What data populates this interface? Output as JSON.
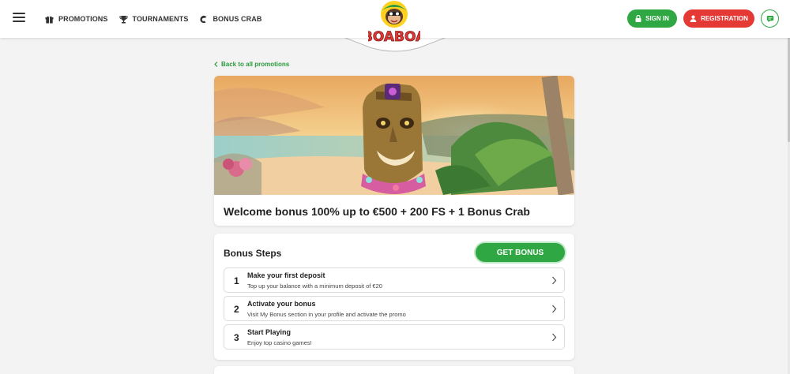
{
  "header": {
    "nav": [
      {
        "label": "PROMOTIONS",
        "icon": "gift-icon"
      },
      {
        "label": "TOURNAMENTS",
        "icon": "trophy-icon"
      },
      {
        "label": "BONUS CRAB",
        "icon": "crab-claw-icon"
      }
    ],
    "logo_text": "BOABOA",
    "signin_label": "SIGN IN",
    "register_label": "REGISTRATION"
  },
  "main": {
    "back_link": "Back to all promotions",
    "promo_title": "Welcome bonus 100% up to €500 + 200 FS + 1 Bonus Crab",
    "steps_title": "Bonus Steps",
    "get_bonus_label": "GET BONUS",
    "steps": [
      {
        "number": "1",
        "title": "Make your first deposit",
        "desc": "Top up your balance with a minimum deposit of €20"
      },
      {
        "number": "2",
        "title": "Activate your bonus",
        "desc": "Visit My Bonus section in your profile and activate the promo"
      },
      {
        "number": "3",
        "title": "Start Playing",
        "desc": "Enjoy top casino games!"
      }
    ]
  },
  "colors": {
    "accent_green": "#2fa843",
    "register_red": "#e53935",
    "background": "#f3f3f3"
  }
}
